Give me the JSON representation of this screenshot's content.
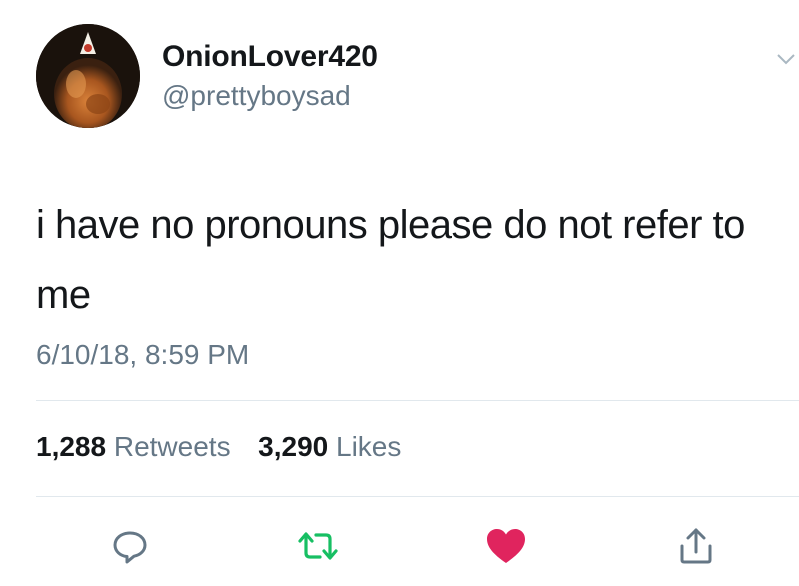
{
  "user": {
    "display_name": "OnionLover420",
    "handle": "@prettyboysad",
    "avatar_icon": "avatar-icon"
  },
  "tweet": {
    "text": "i have no pronouns please do not refer to me",
    "timestamp": "6/10/18, 8:59 PM"
  },
  "stats": {
    "retweets_count": "1,288",
    "retweets_label": "Retweets",
    "likes_count": "3,290",
    "likes_label": "Likes"
  },
  "actions": {
    "reply_icon": "reply-icon",
    "retweet_icon": "retweet-icon",
    "like_icon": "heart-icon",
    "share_icon": "share-icon"
  },
  "colors": {
    "text": "#14171a",
    "secondary": "#657786",
    "retweet_green": "#17bf63",
    "like_red": "#e0245e",
    "divider": "#e1e8ed"
  }
}
